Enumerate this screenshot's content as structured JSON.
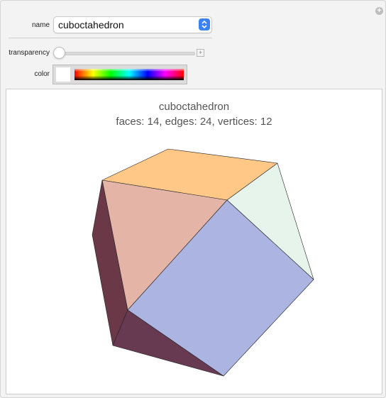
{
  "controls": {
    "name_label": "name",
    "name_value": "cuboctahedron",
    "transparency_label": "transparency",
    "transparency_value": 0,
    "color_label": "color",
    "color_value": "#ffffff"
  },
  "output": {
    "title": "cuboctahedron",
    "stats": "faces: 14, edges: 24, vertices: 12",
    "face_colors": {
      "top_square": "#ffc887",
      "right_triangle": "#e6f4eb",
      "left_triangle": "#e4b5a7",
      "front_square": "#acb4e2",
      "left_side": "#6b3847",
      "bottom_triangle": "#683a52"
    }
  }
}
